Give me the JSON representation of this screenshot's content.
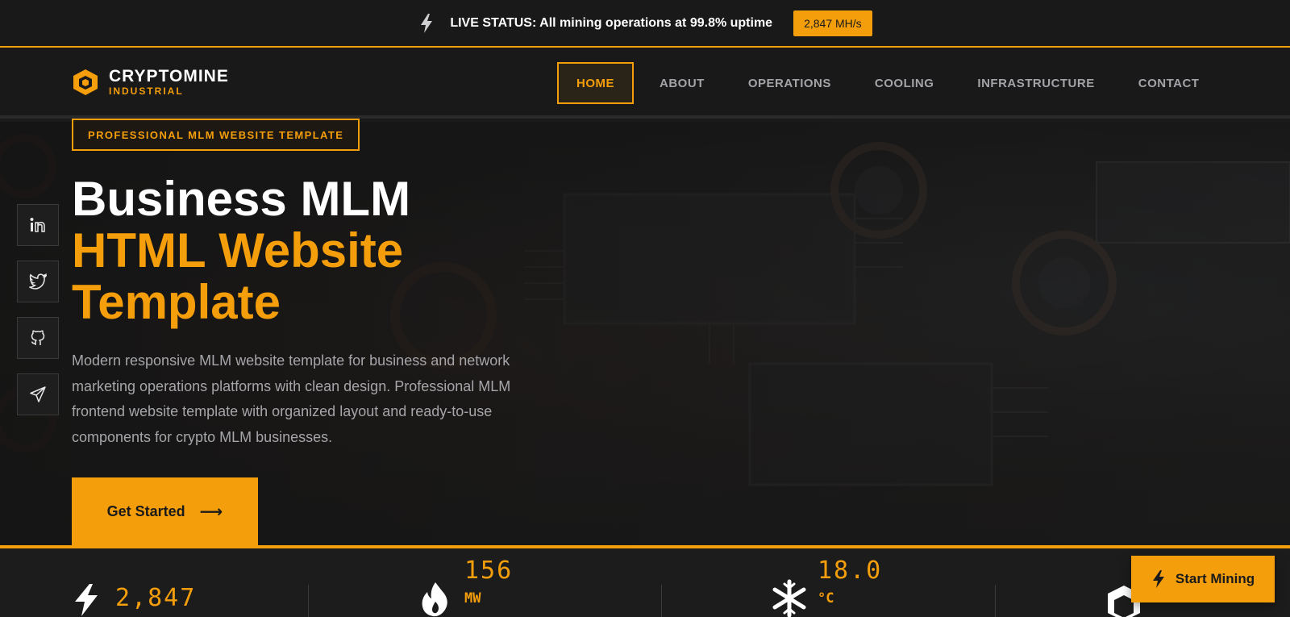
{
  "status_bar": {
    "text": "LIVE STATUS: All mining operations at 99.8% uptime",
    "hashrate": "2,847 MH/s"
  },
  "logo": {
    "name": "CRYPTOMINE",
    "sub": "INDUSTRIAL"
  },
  "nav": {
    "items": [
      {
        "label": "HOME",
        "active": true
      },
      {
        "label": "ABOUT"
      },
      {
        "label": "OPERATIONS"
      },
      {
        "label": "COOLING"
      },
      {
        "label": "INFRASTRUCTURE"
      },
      {
        "label": "CONTACT"
      }
    ]
  },
  "hero": {
    "badge": "PROFESSIONAL MLM WEBSITE TEMPLATE",
    "title_line1": "Business MLM",
    "title_line2": "HTML Website",
    "title_line3": "Template",
    "description": "Modern responsive MLM website template for business and network marketing operations platforms with clean design. Professional MLM frontend website template with organized layout and ready-to-use components for crypto MLM businesses.",
    "cta": "Get Started",
    "cta_arrow": "⟶"
  },
  "socials": [
    "linkedin-icon",
    "twitter-icon",
    "github-icon",
    "telegram-icon"
  ],
  "stats": [
    {
      "value": "2,847",
      "unit": "",
      "icon": "bolt-icon"
    },
    {
      "value": "156",
      "unit": "MW",
      "icon": "flame-icon"
    },
    {
      "value": "18.0",
      "unit": "°C",
      "icon": "snowflake-icon"
    },
    {
      "value": "",
      "unit": "%",
      "icon": "cube-icon"
    }
  ],
  "floating_button": {
    "label": "Start Mining"
  },
  "colors": {
    "accent": "#f59e0b",
    "background": "#1a1a1b"
  }
}
